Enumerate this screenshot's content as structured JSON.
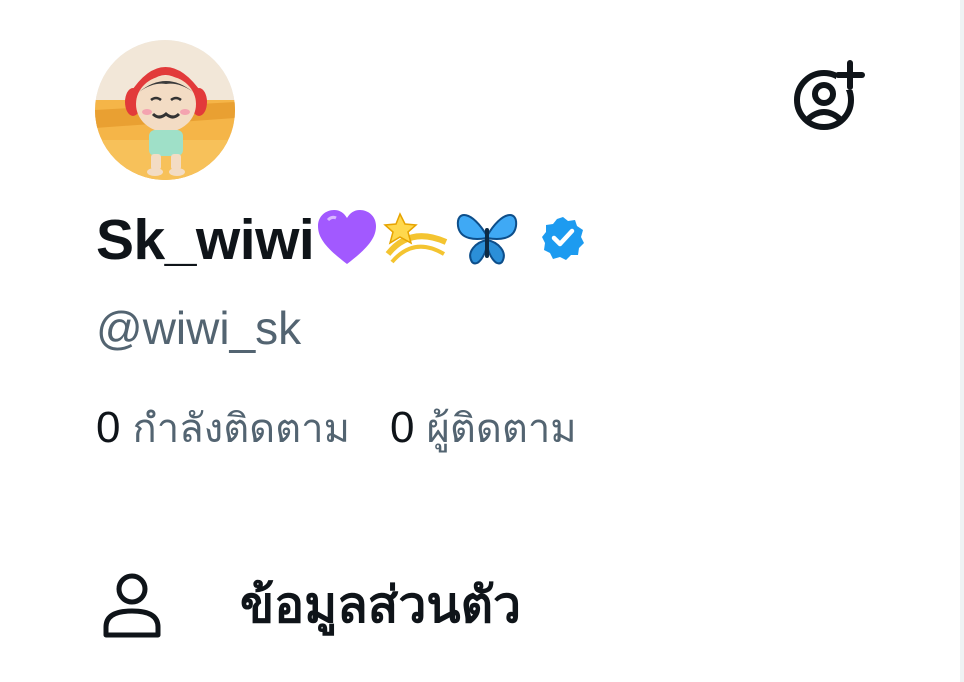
{
  "profile": {
    "display_name": "Sk_wiwi",
    "handle": "@wiwi_sk",
    "name_emojis": [
      "purple-heart-icon",
      "dizzy-star-icon",
      "butterfly-icon"
    ],
    "verified": true,
    "verified_color": "#1d9bf0"
  },
  "stats": {
    "following_count": "0",
    "following_label": "กำลังติดตาม",
    "followers_count": "0",
    "followers_label": "ผู้ติดตาม"
  },
  "menu": {
    "items": [
      {
        "label": "ข้อมูลส่วนตัว",
        "icon": "person-icon"
      }
    ]
  },
  "colors": {
    "text_primary": "#0f1419",
    "text_secondary": "#536471",
    "background": "#ffffff"
  }
}
